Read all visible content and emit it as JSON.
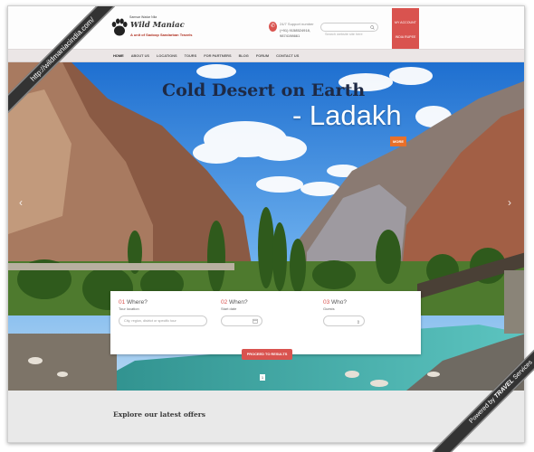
{
  "logo": {
    "tagline_small": "Samsar Wadar Nila",
    "name": "Wild Maniac",
    "subtitle": "A unit of Sadoop Sandarban Travels"
  },
  "support": {
    "label": "24/7 Support number",
    "phone1": "(+91) 9158524918,",
    "phone2": "9874198661"
  },
  "search": {
    "placeholder": "Search website site here"
  },
  "account": {
    "my_account": "MY ACCOUNT",
    "currency": "INDIA RUPEE"
  },
  "nav": {
    "items": [
      "HOME",
      "ABOUT US",
      "LOCATIONS",
      "TOURS",
      "FOR PARTNERS",
      "BLOG",
      "FORUM",
      "CONTACT US"
    ]
  },
  "hero": {
    "title_line1": "Cold Desert on Earth",
    "title_line2": "- Ladakh",
    "more_label": "MORE",
    "prev_icon": "chevron-left-icon",
    "next_icon": "chevron-right-icon"
  },
  "booking": {
    "where": {
      "num": "01",
      "title": "Where?",
      "label": "Tour location",
      "placeholder": "City, region, district or specific tour"
    },
    "when": {
      "num": "02",
      "title": "When?",
      "label": "Start date",
      "placeholder": ""
    },
    "who": {
      "num": "03",
      "title": "Who?",
      "label": "Guests",
      "value": ""
    },
    "proceed_label": "PROCEED TO RESULTS"
  },
  "slide": {
    "indicator": "1"
  },
  "offers": {
    "title": "Explore our latest offers"
  },
  "watermarks": {
    "top_left": "http://wildmaniacindia.com/",
    "bottom_right_prefix": "Powered by",
    "bottom_right_brand": "TRAVEL",
    "bottom_right_suffix": "Services"
  },
  "colors": {
    "accent": "#d9534f",
    "more_button": "#e8702a",
    "title_dark": "#1e2a45"
  }
}
